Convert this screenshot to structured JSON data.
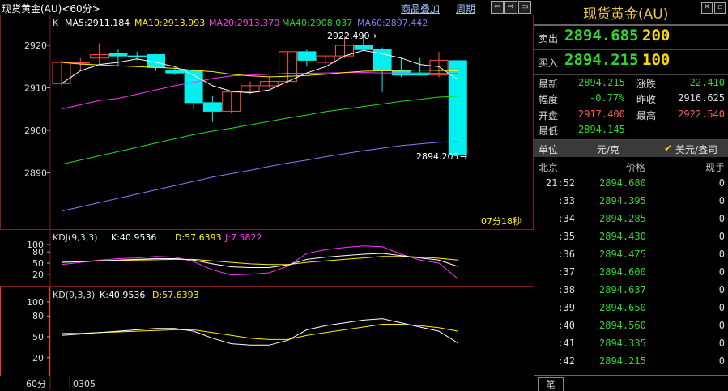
{
  "header": {
    "title": "现货黄金(AU)<60分>",
    "links": [
      "商品叠加",
      "周期"
    ],
    "nav_glyphs": [
      "⇦",
      "⇨",
      "▭"
    ]
  },
  "main_chart": {
    "label_k": "K",
    "ma5": "MA5:2911.184",
    "ma10": "MA10:2913.993",
    "ma20": "MA20:2913.370",
    "ma40": "MA40:2908.037",
    "ma60": "MA60:2897.442",
    "y_ticks": [
      "2920",
      "2910",
      "2900",
      "2890"
    ],
    "high_label": "2922.490",
    "low_label": "2894.205",
    "countdown": "07分18秒"
  },
  "kdj_panel": {
    "title": "KDJ(9,3,3)",
    "k": "K:40.9536",
    "d": "D:57.6393",
    "j": "J:7.5822",
    "y_ticks": [
      "100",
      "80",
      "50",
      "20"
    ]
  },
  "kd_panel": {
    "title": "KD(9,3,3)",
    "k": "K:40.9536",
    "d": "D:57.6393",
    "y_ticks": [
      "100",
      "80",
      "50",
      "20"
    ]
  },
  "bottom": {
    "period": "60分",
    "date": "0305"
  },
  "side": {
    "title": "现货黄金(AU)",
    "sell_label": "卖出",
    "sell_price": "2894.685",
    "sell_qty": "200",
    "buy_label": "买入",
    "buy_price": "2894.215",
    "buy_qty": "100",
    "stats": {
      "latest_label": "最新",
      "latest": "2894.215",
      "change_label": "涨跌",
      "change": "-22.410",
      "pct_label": "幅度",
      "pct": "-0.77%",
      "prev_label": "昨收",
      "prev": "2916.625",
      "open_label": "开盘",
      "open": "2917.400",
      "high_label": "最高",
      "high": "2922.540",
      "low_label": "最低",
      "low": "2894.145"
    },
    "unit_label": "单位",
    "unit_value": "元/克",
    "unit_option": "美元/盎司",
    "col_headers": [
      "北京",
      "价格",
      "现手"
    ],
    "ticks": [
      {
        "time": "21:52",
        "price": "2894.680",
        "vol": "0"
      },
      {
        "time": ":33",
        "price": "2894.395",
        "vol": "0"
      },
      {
        "time": ":34",
        "price": "2894.285",
        "vol": "0"
      },
      {
        "time": ":35",
        "price": "2894.430",
        "vol": "0"
      },
      {
        "time": ":36",
        "price": "2894.475",
        "vol": "0"
      },
      {
        "time": ":37",
        "price": "2894.600",
        "vol": "0"
      },
      {
        "time": ":38",
        "price": "2894.637",
        "vol": "0"
      },
      {
        "time": ":39",
        "price": "2894.650",
        "vol": "0"
      },
      {
        "time": ":40",
        "price": "2894.560",
        "vol": "0"
      },
      {
        "time": ":41",
        "price": "2894.335",
        "vol": "0"
      },
      {
        "time": ":42",
        "price": "2894.215",
        "vol": "0"
      }
    ],
    "tab": "笔"
  },
  "colors": {
    "up": "#ff4d4d",
    "down": "#00f0f0",
    "ma5": "#ffffff",
    "ma10": "#ffee00",
    "ma20": "#ff33ff",
    "ma40": "#22dd22",
    "ma60": "#8080ff",
    "grid": "#7a1f1f"
  }
}
